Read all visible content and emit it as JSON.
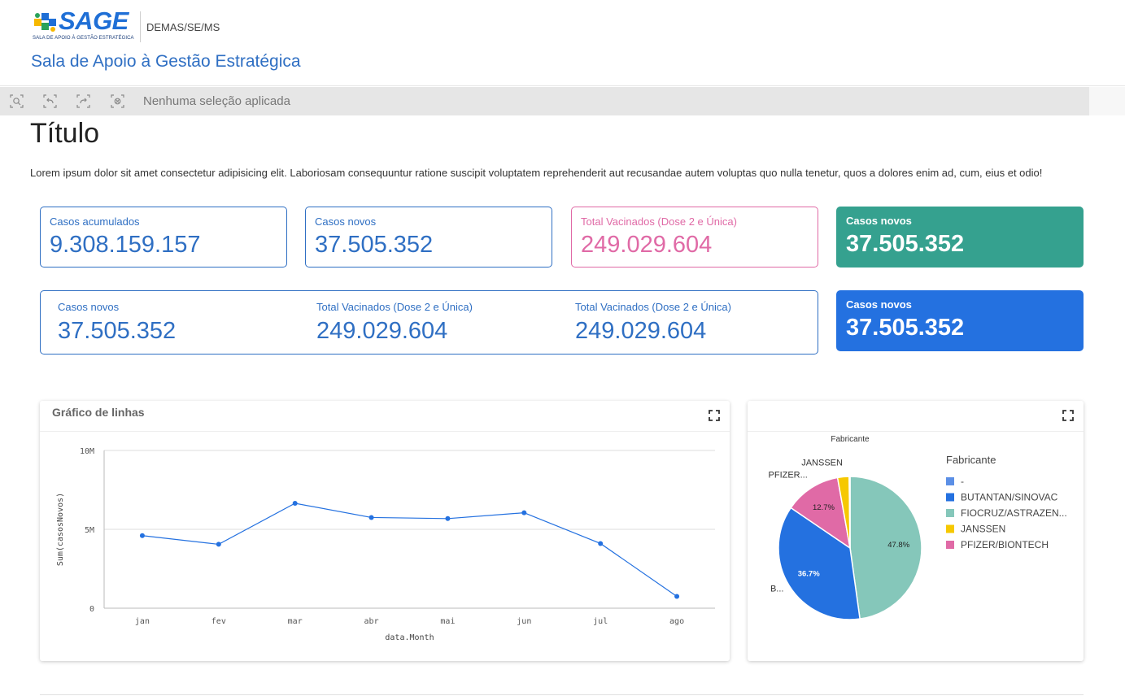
{
  "header": {
    "logo_text": "SAGE",
    "logo_subtitle": "SALA DE APOIO À GESTÃO ESTRATÉGICA",
    "org": "DEMAS/SE/MS",
    "app_title": "Sala de Apoio à Gestão Estratégica"
  },
  "toolbar": {
    "icons": [
      "zoom-selection-icon",
      "step-back-icon",
      "step-forward-icon",
      "clear-selections-icon"
    ],
    "status": "Nenhuma seleção aplicada"
  },
  "page": {
    "title": "Título",
    "description": "Lorem ipsum dolor sit amet consectetur adipisicing elit. Laboriosam consequuntur ratione suscipit voluptatem reprehenderit aut recusandae autem voluptas quo nulla tenetur, quos a dolores enim ad, cum, eius et odio!"
  },
  "kpis": {
    "row1": [
      {
        "label": "Casos acumulados",
        "value": "9.308.159.157",
        "style": "outline-blue"
      },
      {
        "label": "Casos novos",
        "value": "37.505.352",
        "style": "outline-blue"
      },
      {
        "label": "Total Vacinados (Dose 2 e Única)",
        "value": "249.029.604",
        "style": "outline-pink"
      },
      {
        "label": "Casos novos",
        "value": "37.505.352",
        "style": "solid-green"
      }
    ],
    "row2_multi": [
      {
        "label": "Casos novos",
        "value": "37.505.352"
      },
      {
        "label": "Total Vacinados (Dose 2 e Única)",
        "value": "249.029.604"
      },
      {
        "label": "Total Vacinados (Dose 2 e Única)",
        "value": "249.029.604"
      }
    ],
    "row2_solid": {
      "label": "Casos novos",
      "value": "37.505.352",
      "style": "solid-blue"
    }
  },
  "colors": {
    "primary": "#2f6fc3",
    "pink": "#e06aa6",
    "green": "#35a18f",
    "blue_solid": "#2471e0",
    "line": "#2471e0"
  },
  "line_card": {
    "title": "Gráfico de linhas"
  },
  "pie_card": {
    "title": "Fabricante",
    "legend_title": "Fabricante"
  },
  "chart_data": [
    {
      "type": "line",
      "title": "Gráfico de linhas",
      "xlabel": "data.Month",
      "ylabel": "Sum(casosNovos)",
      "categories": [
        "jan",
        "fev",
        "mar",
        "abr",
        "mai",
        "jun",
        "jul",
        "ago"
      ],
      "values": [
        4600000,
        4050000,
        6650000,
        5750000,
        5680000,
        6050000,
        4100000,
        750000
      ],
      "ylim": [
        0,
        10000000
      ],
      "yticks": [
        {
          "value": 0,
          "label": "0"
        },
        {
          "value": 5000000,
          "label": "5M"
        },
        {
          "value": 10000000,
          "label": "10M"
        }
      ],
      "grid": true,
      "legend": "none"
    },
    {
      "type": "pie",
      "title": "Fabricante",
      "categories": [
        "-",
        "BUTANTAN/SINOVAC",
        "FIOCRUZ/ASTRAZENECA",
        "JANSSEN",
        "PFIZER/BIONTECH"
      ],
      "legend_labels": [
        "-",
        "BUTANTAN/SINOVAC",
        "FIOCRUZ/ASTRAZEN...",
        "JANSSEN",
        "PFIZER/BIONTECH"
      ],
      "outer_labels": [
        "",
        "B...",
        "",
        "JANSSEN",
        "PFIZER..."
      ],
      "values": [
        0.2,
        36.7,
        47.8,
        2.6,
        12.7
      ],
      "value_labels": [
        "",
        "36.7%",
        "47.8%",
        "",
        "12.7%"
      ],
      "colors": [
        "#5b8fe6",
        "#2471e0",
        "#85c7ba",
        "#f6c800",
        "#e06aa6"
      ],
      "legend": "right"
    }
  ]
}
